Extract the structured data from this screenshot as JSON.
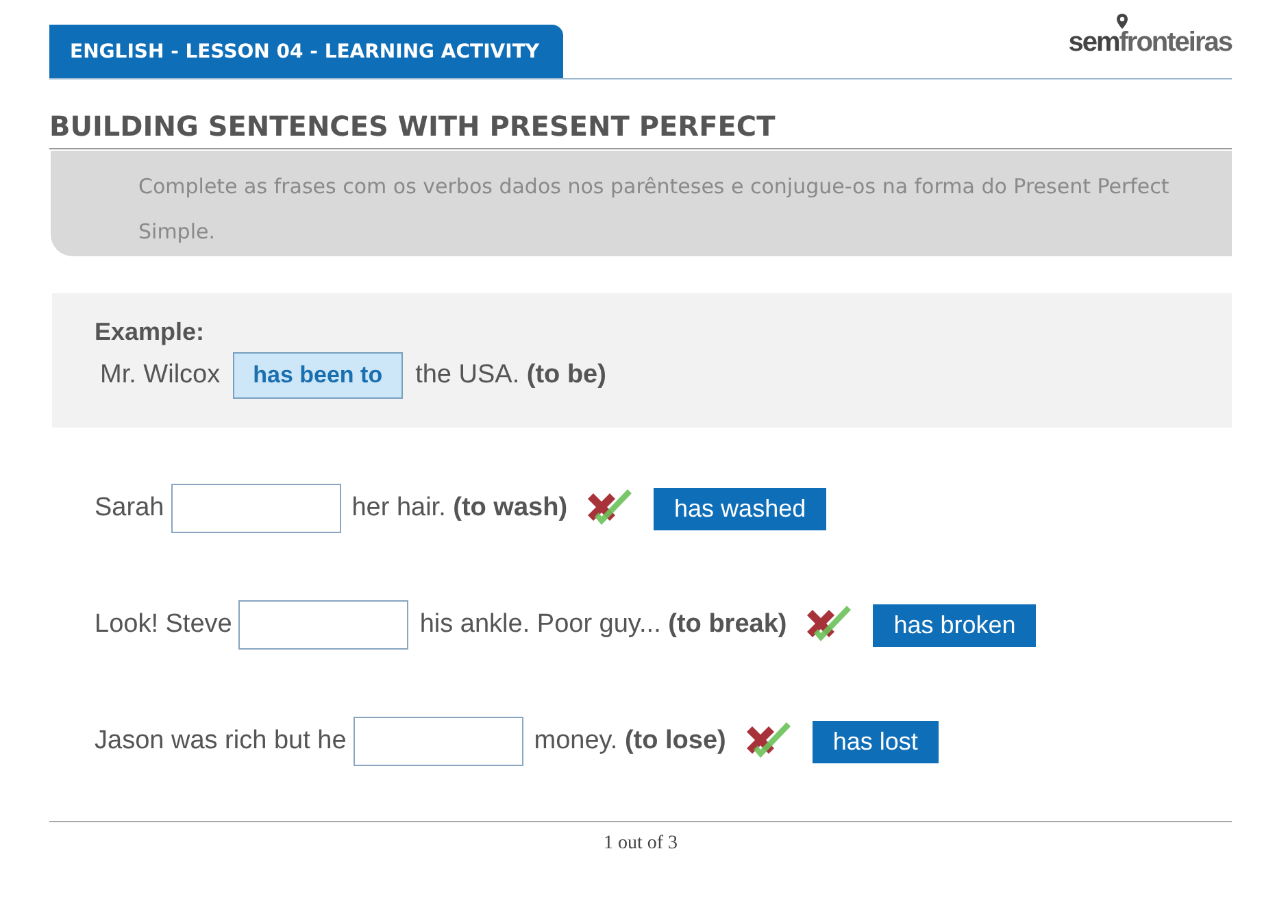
{
  "header": {
    "title": "ENGLISH - LESSON 04 - LEARNING ACTIVITY",
    "logo": {
      "part_1": "sem",
      "part_2": "fronteiras"
    }
  },
  "heading": "BUILDING SENTENCES WITH PRESENT PERFECT",
  "instructions": "Complete as frases com os verbos dados nos parênteses e conjugue-os na forma do Present Perfect Simple.",
  "example": {
    "label": "Example:",
    "before": "Mr. Wilcox",
    "answer": "has been to",
    "after": "the USA. **(to be)**"
  },
  "exercises": [
    {
      "before": "Sarah",
      "after": "her hair. **(to wash)**",
      "answer": "has washed"
    },
    {
      "before": "Look! Steve",
      "after": "his ankle. Poor guy... **(to break)**",
      "answer": "has broken"
    },
    {
      "before": "Jason was rich but he",
      "after": "money. **(to lose)**",
      "answer": "has lost"
    }
  ],
  "pager": "1 out of 3"
}
